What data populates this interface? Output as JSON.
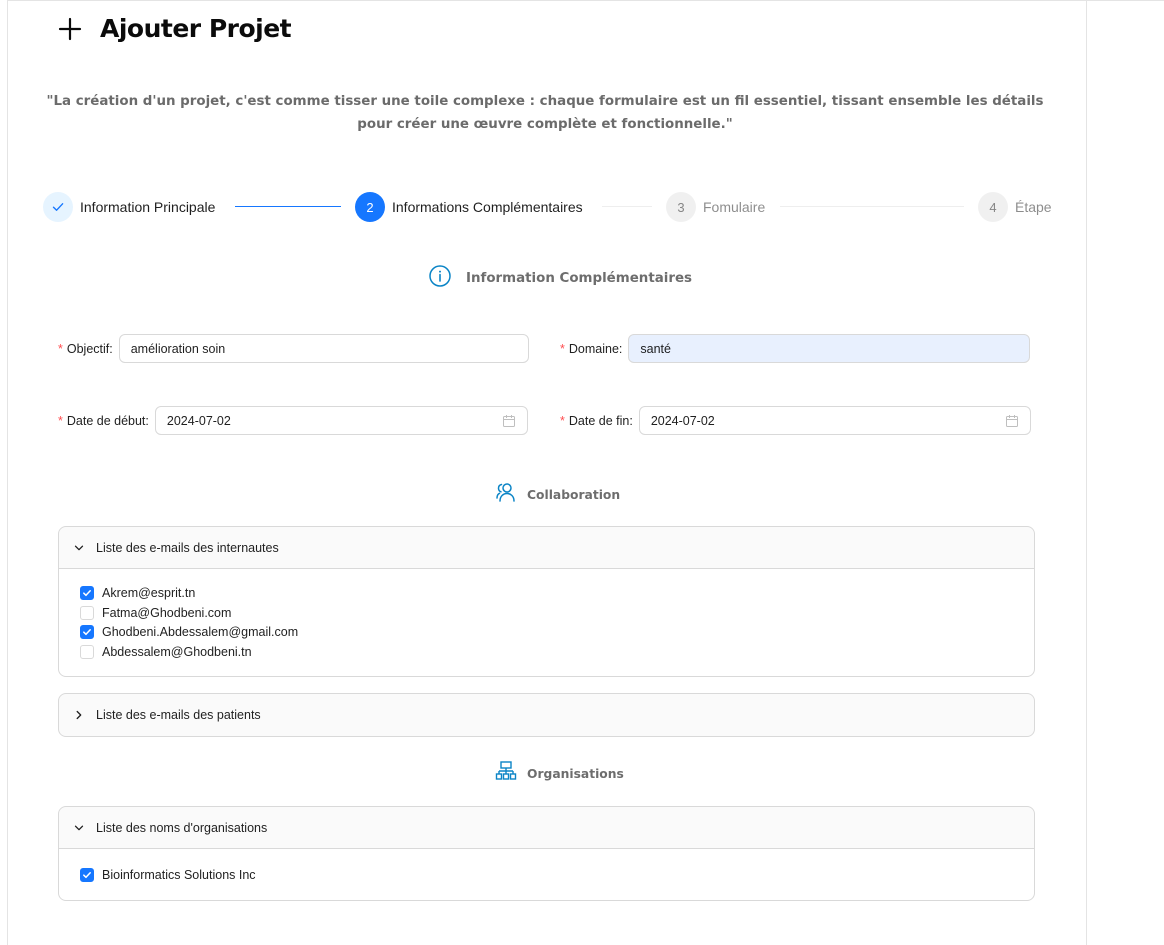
{
  "header": {
    "title": "Ajouter Projet",
    "quote": "\"La création d'un projet, c'est comme tisser une toile complexe : chaque formulaire est un fil essentiel, tissant ensemble les détails pour créer une œuvre complète et fonctionnelle.\""
  },
  "steps": [
    {
      "number": "",
      "label": "Information Principale",
      "status": "finished"
    },
    {
      "number": "2",
      "label": "Informations Complémentaires",
      "status": "active"
    },
    {
      "number": "3",
      "label": "Fomulaire",
      "status": "waiting"
    },
    {
      "number": "4",
      "label": "Étape",
      "status": "waiting"
    }
  ],
  "sections": {
    "info": "Information Complémentaires",
    "collaboration": "Collaboration",
    "organisations": "Organisations"
  },
  "form": {
    "required_mark": "*",
    "objectif": {
      "label": "Objectif:",
      "value": "amélioration soin"
    },
    "domaine": {
      "label": "Domaine:",
      "value": "santé"
    },
    "date_debut": {
      "label": "Date de début:",
      "value": "2024-07-02"
    },
    "date_fin": {
      "label": "Date de fin:",
      "value": "2024-07-02"
    }
  },
  "collaboration": {
    "internautes": {
      "title": "Liste des e-mails des internautes",
      "expanded": true,
      "items": [
        {
          "email": "Akrem@esprit.tn",
          "checked": true
        },
        {
          "email": "Fatma@Ghodbeni.com",
          "checked": false
        },
        {
          "email": "Ghodbeni.Abdessalem@gmail.com",
          "checked": true
        },
        {
          "email": "Abdessalem@Ghodbeni.tn",
          "checked": false
        }
      ]
    },
    "patients": {
      "title": "Liste des e-mails des patients",
      "expanded": false
    }
  },
  "organisations": {
    "title": "Liste des noms d'organisations",
    "expanded": true,
    "items": [
      {
        "name": "Bioinformatics Solutions Inc",
        "checked": true
      }
    ]
  },
  "colors": {
    "primary": "#1677ff",
    "section_icon": "#0a84c6",
    "required": "#ff4d4f",
    "autofill_bg": "#e8f0fe"
  },
  "icons": {
    "title": "plus-icon",
    "step1": "check-icon",
    "info_section": "info-circle-icon",
    "collaboration_section": "team-icon",
    "organisations_section": "cluster-icon",
    "date": "calendar-icon",
    "collapse_open": "chevron-down-icon",
    "collapse_closed": "chevron-right-icon"
  }
}
